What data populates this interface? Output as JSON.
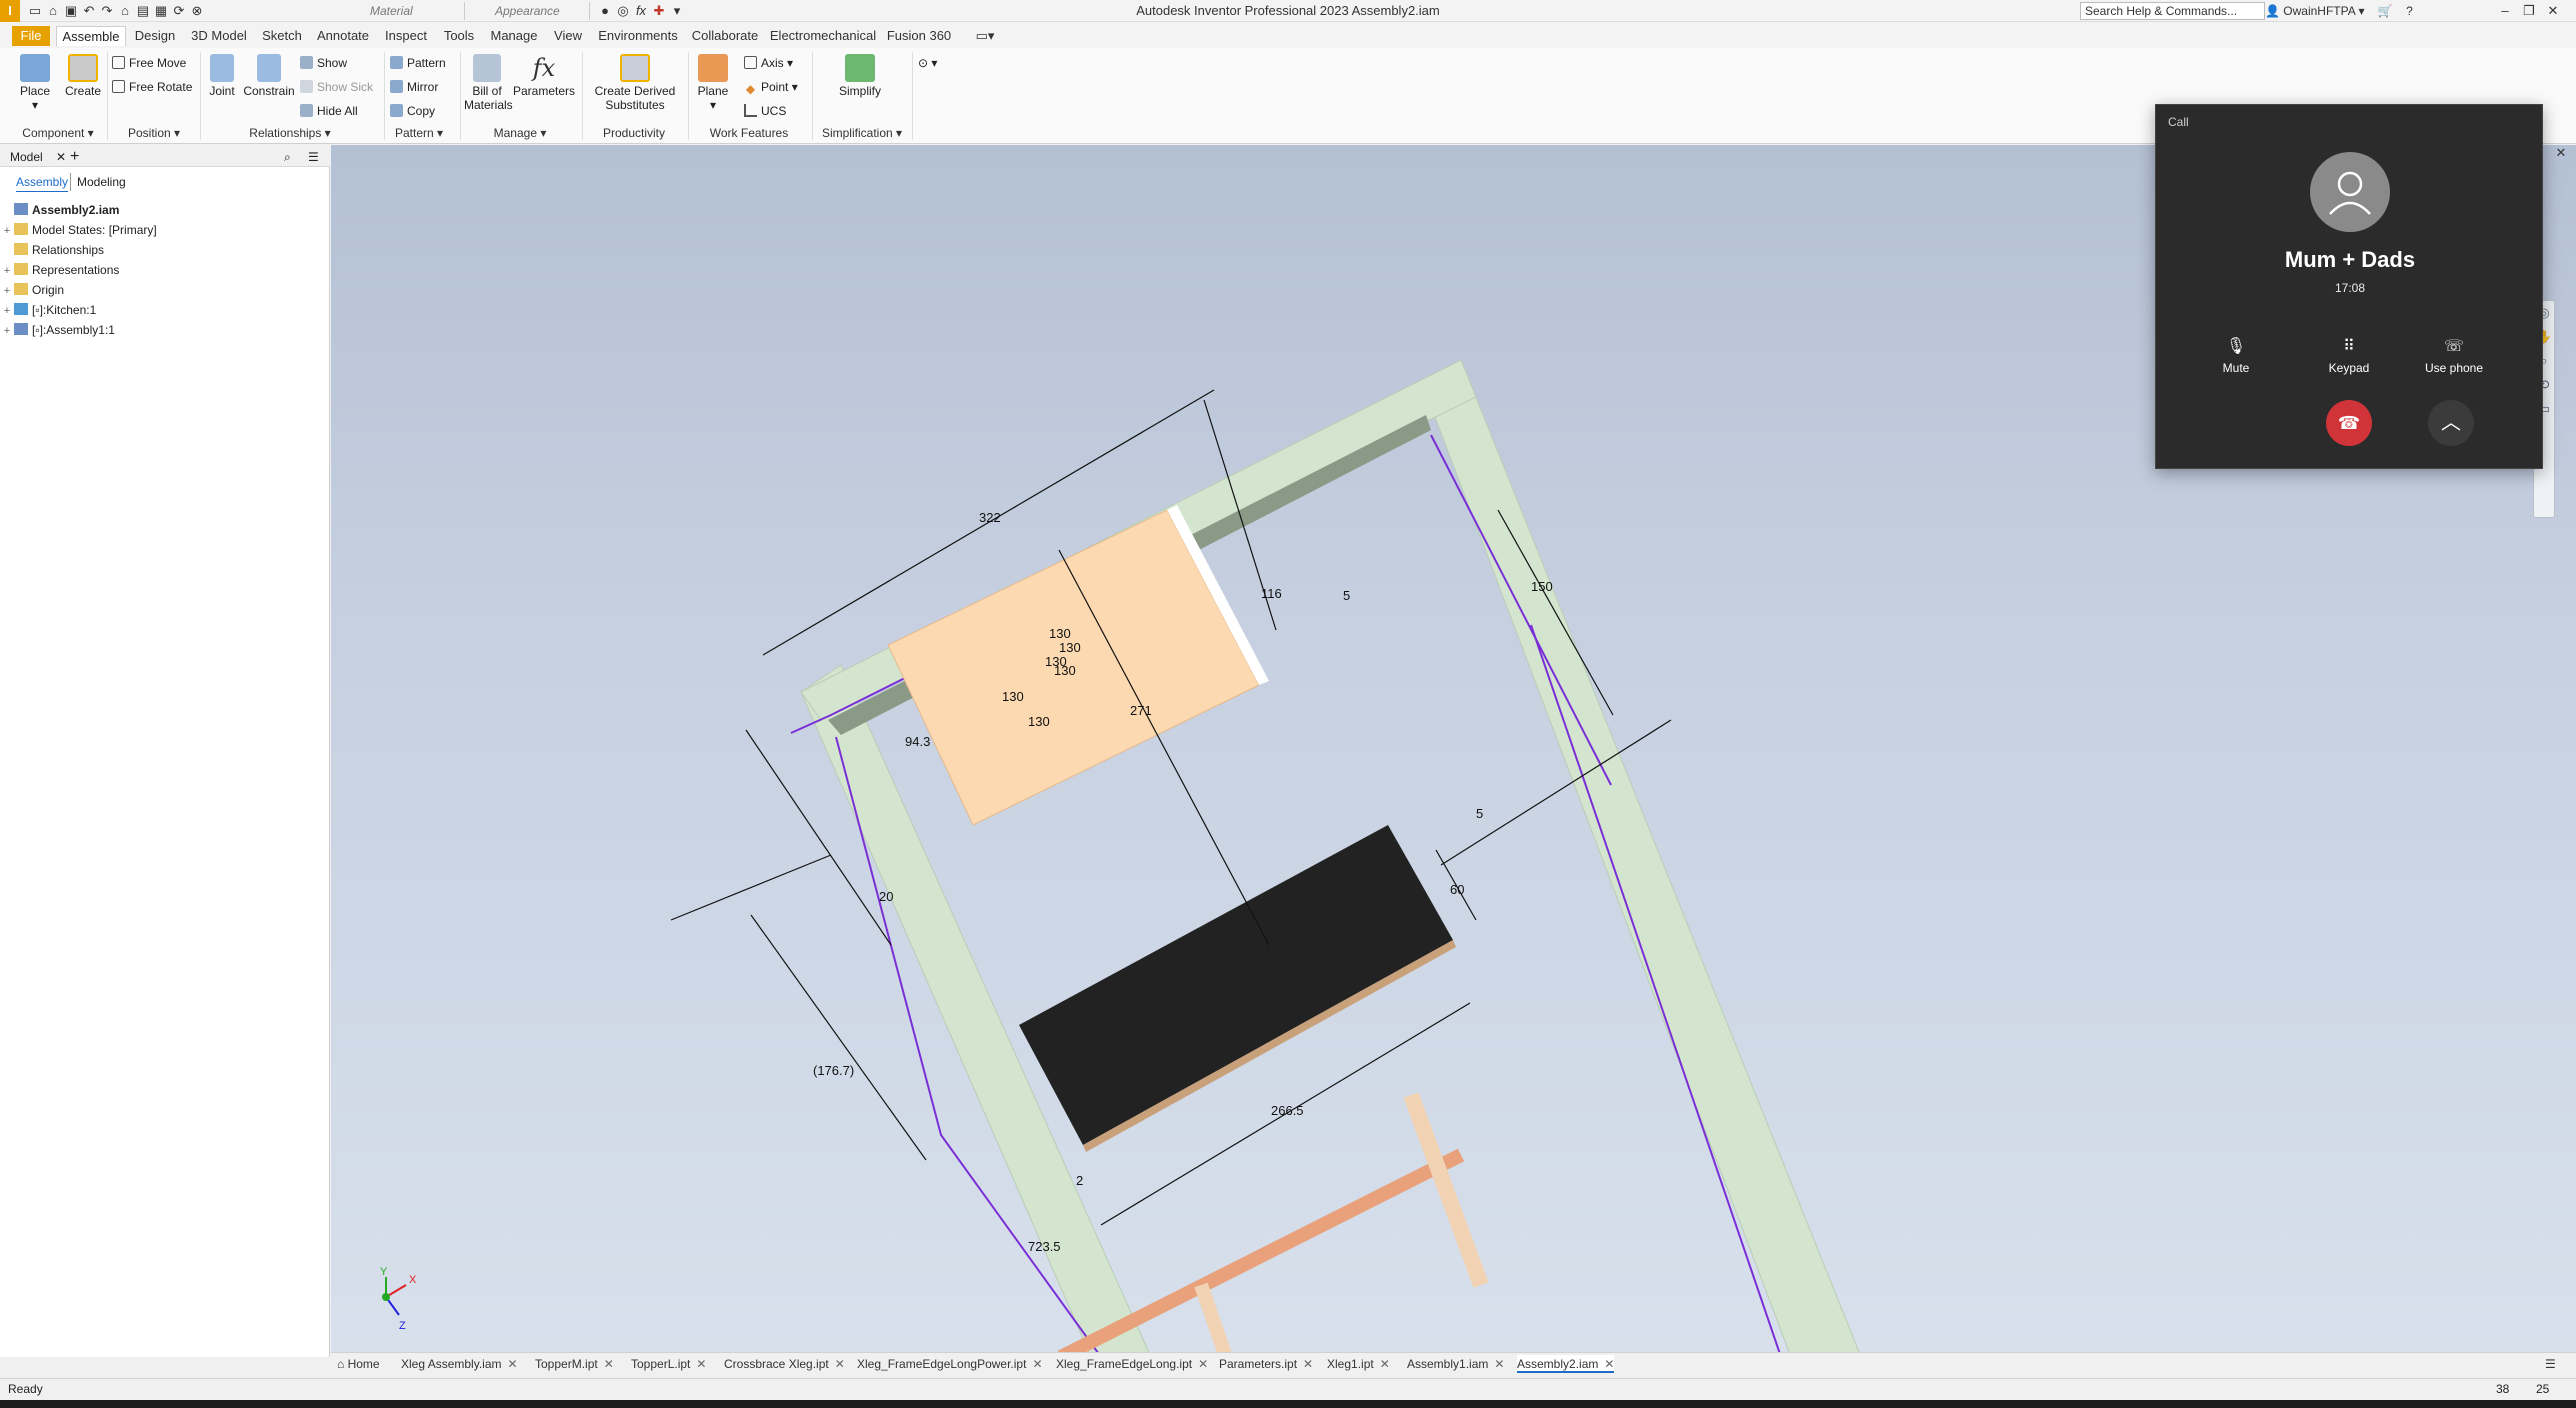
{
  "window": {
    "app_letter": "I",
    "title": "Autodesk Inventor Professional 2023   Assembly2.iam",
    "material_placeholder": "Material",
    "appearance_placeholder": "Appearance",
    "search_placeholder": "Search Help & Commands...",
    "user": "OwainHFTPA"
  },
  "menu": {
    "tabs": [
      "File",
      "Assemble",
      "Design",
      "3D Model",
      "Sketch",
      "Annotate",
      "Inspect",
      "Tools",
      "Manage",
      "View",
      "Environments",
      "Collaborate",
      "Electromechanical",
      "Fusion 360"
    ],
    "active": "Assemble"
  },
  "ribbon": {
    "place": "Place",
    "create": "Create",
    "free_move": "Free Move",
    "free_rotate": "Free Rotate",
    "joint": "Joint",
    "constrain": "Constrain",
    "show": "Show",
    "show_sick": "Show Sick",
    "hide_all": "Hide All",
    "pattern": "Pattern",
    "mirror": "Mirror",
    "copy": "Copy",
    "bill_of": "Bill of",
    "materials": "Materials",
    "parameters": "Parameters",
    "create_derived": "Create Derived",
    "substitutes": "Substitutes",
    "plane": "Plane",
    "axis": "Axis",
    "point": "Point",
    "ucs": "UCS",
    "simplify": "Simplify",
    "groups": {
      "component": "Component",
      "position": "Position",
      "relationships": "Relationships",
      "pattern": "Pattern",
      "manage": "Manage",
      "productivity": "Productivity",
      "work_features": "Work Features",
      "simplification": "Simplification"
    }
  },
  "browser": {
    "tab_model": "Model",
    "sub_assembly": "Assembly",
    "sub_modeling": "Modeling",
    "tree": [
      "Assembly2.iam",
      "Model States: [Primary]",
      "Relationships",
      "Representations",
      "Origin",
      "[▫]:Kitchen:1",
      "[▫]:Assembly1:1"
    ]
  },
  "dimensions": {
    "d322": "322",
    "d116": "116",
    "d150": "150",
    "d271": "271",
    "d94": "94.3",
    "d20": "20",
    "d60": "60",
    "d176": "(176.7)",
    "d266": "266.5",
    "d723": "723.5",
    "d5a": "5",
    "d5b": "5",
    "d2": "2",
    "d130": "130"
  },
  "axes": {
    "x": "X",
    "y": "Y",
    "z": "Z"
  },
  "doc_tabs": [
    "Xleg Assembly.iam",
    "TopperM.ipt",
    "TopperL.ipt",
    "Crossbrace Xleg.ipt",
    "Xleg_FrameEdgeLongPower.ipt",
    "Xleg_FrameEdgeLong.ipt",
    "Parameters.ipt",
    "Xleg1.ipt",
    "Assembly1.iam",
    "Assembly2.iam"
  ],
  "home_tab": "Home",
  "active_doc": "Assembly2.iam",
  "status": {
    "text": "Ready",
    "n1": "38",
    "n2": "25"
  },
  "call": {
    "header": "Call",
    "name": "Mum + Dads",
    "duration": "17:08",
    "mute": "Mute",
    "keypad": "Keypad",
    "use_phone": "Use phone"
  },
  "colors": {
    "accent_orange": "#e6a000",
    "frame_green": "#d2e3cf",
    "purple_line": "#7a2fd6",
    "hangup_red": "#d13438",
    "panel_tan": "#fcd9b0"
  }
}
